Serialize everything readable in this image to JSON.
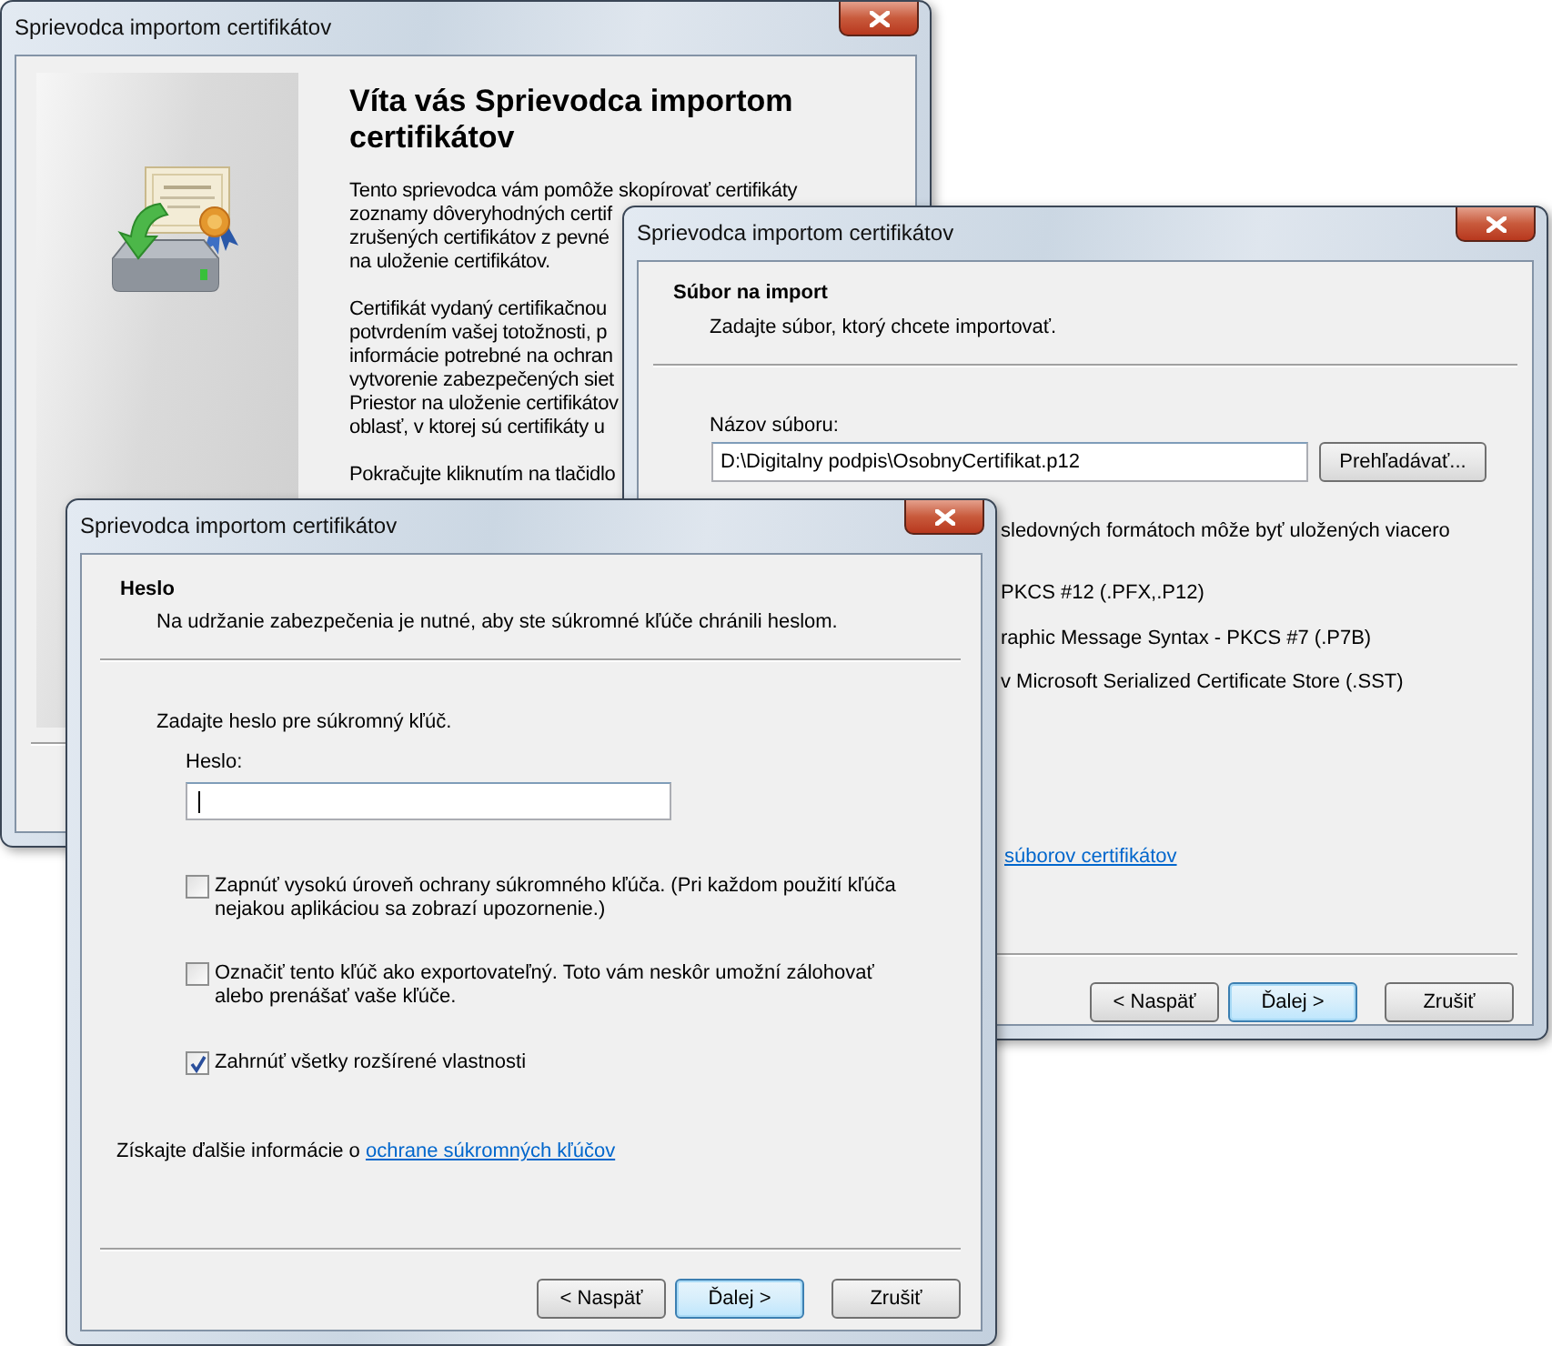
{
  "windows": [
    {
      "kind": "welcome",
      "title": "Sprievodca importom certifikátov",
      "heading": "Víta vás Sprievodca importom certifikátov",
      "paragraphs": [
        [
          "Tento sprievodca vám pomôže skopírovať certifikáty",
          "zoznamy dôveryhodných certif",
          "zrušených certifikátov z pevné",
          "na uloženie certifikátov."
        ],
        [
          "Certifikát vydaný certifikačnou",
          "potvrdením vašej totožnosti, p",
          "informácie potrebné na ochran",
          "vytvorenie zabezpečených siet",
          "Priestor na uloženie certifikátov",
          "oblasť, v ktorej sú certifikáty u"
        ],
        [
          "Pokračujte kliknutím na tlačidlo"
        ]
      ]
    },
    {
      "kind": "file",
      "title": "Sprievodca importom certifikátov",
      "section_title": "Súbor na import",
      "section_subtitle": "Zadajte súbor, ktorý chcete importovať.",
      "file_label": "Názov súboru:",
      "file_value": "D:\\Digitalny podpis\\OsobnyCertifikat.p12",
      "browse_button": "Prehľadávať...",
      "format_lines": [
        "sledovných formátoch môže byť uložených viacero",
        "PKCS #12 (.PFX,.P12)",
        "raphic Message Syntax - PKCS #7 (.P7B)",
        "v Microsoft Serialized Certificate Store (.SST)"
      ],
      "link": "súborov certifikátov",
      "buttons": [
        {
          "label": "< Naspäť",
          "default": false
        },
        {
          "label": "Ďalej >",
          "default": true
        },
        {
          "label": "Zrušiť",
          "default": false
        }
      ]
    },
    {
      "kind": "password",
      "title": "Sprievodca importom certifikátov",
      "section_title": "Heslo",
      "section_subtitle": "Na udržanie zabezpečenia je nutné, aby ste súkromné kľúče chránili heslom.",
      "prompt": "Zadajte heslo pre súkromný kľúč.",
      "password_label": "Heslo:",
      "password_focused": true,
      "checkboxes": [
        {
          "label": "Zapnúť vysokú úroveň ochrany súkromného kľúča. (Pri každom použití kľúča nejakou aplikáciou sa zobrazí upozornenie.)",
          "checked": false
        },
        {
          "label": "Označiť tento kľúč ako exportovateľný. Toto vám neskôr umožní zálohovať alebo prenášať vaše kľúče.",
          "checked": false
        },
        {
          "label": "Zahrnúť všetky rozšírené vlastnosti",
          "checked": true
        }
      ],
      "info_text": "Získajte ďalšie informácie o",
      "info_link": "ochrane súkromných kľúčov",
      "buttons": [
        {
          "label": "< Naspäť",
          "default": false
        },
        {
          "label": "Ďalej >",
          "default": true
        },
        {
          "label": "Zrušiť",
          "default": false
        }
      ]
    }
  ]
}
